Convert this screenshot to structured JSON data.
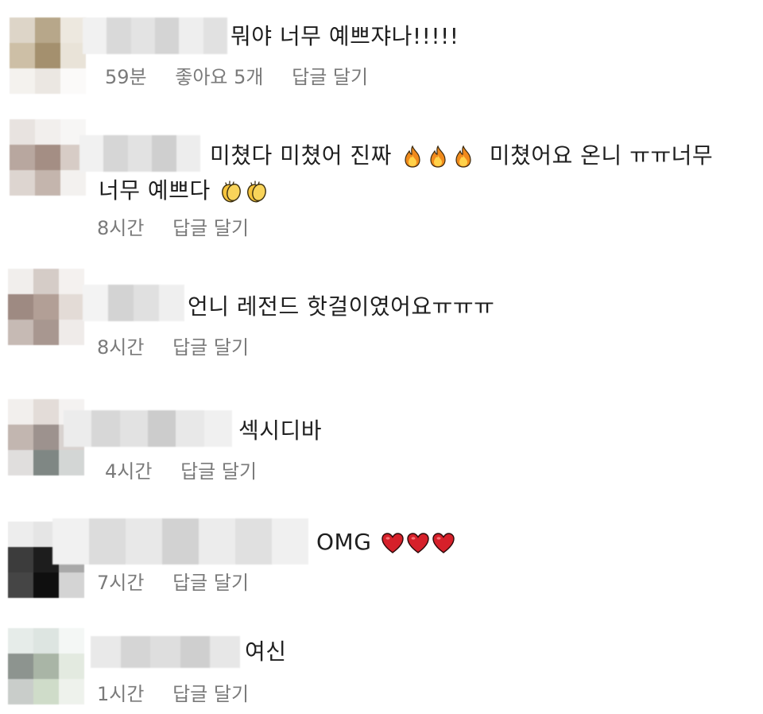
{
  "comments": [
    {
      "text": "뭐야 너무 예쁘쟈나!!!!!",
      "time": "59분",
      "likes": "좋아요 5개",
      "reply": "답글 달기",
      "emoji": [],
      "avatar_colors": [
        "#ddd5c8",
        "#b7a78a",
        "#ede8df",
        "#cdbfa6",
        "#a4906e",
        "#e9e3d8",
        "#f4f2ee",
        "#ebe7e2",
        "#fbfaf9"
      ],
      "name_colors": [
        "#f1f1f1",
        "#d9d9d9",
        "#e3e3e3",
        "#d4d4d4",
        "#eeeeee",
        "#e1e1e1"
      ]
    },
    {
      "text": "미쳤다 미쳤어 진짜",
      "text2": "미쳤어요 온니 ㅠㅠ너무",
      "text3": "너무 예쁘다",
      "time": "8시간",
      "reply": "답글 달기",
      "emoji": [
        "fire",
        "fire",
        "fire"
      ],
      "emoji2": [
        "clap",
        "clap"
      ],
      "avatar_colors": [
        "#e8e3e0",
        "#f2efed",
        "#f7f6f5",
        "#b8a79f",
        "#a48e84",
        "#d7ccc6",
        "#ddd5d0",
        "#c4b5ad",
        "#f3f1ef"
      ],
      "name_colors": [
        "#f1f1f1",
        "#d6d6d6",
        "#e2e2e2",
        "#cfcfcf",
        "#ededed"
      ]
    },
    {
      "text": "언니 레전드 핫걸이였어요ㅠㅠㅠ",
      "time": "8시간",
      "reply": "답글 달기",
      "emoji": [],
      "avatar_colors": [
        "#f1eeec",
        "#d5ccc7",
        "#f4f1ef",
        "#9e8a82",
        "#b29f96",
        "#e3dbd6",
        "#c6bab4",
        "#a89790",
        "#efebe9"
      ],
      "name_colors": [
        "#f3f3f3",
        "#d3d3d3",
        "#e0e0e0",
        "#efefef"
      ]
    },
    {
      "text": "섹시디바",
      "time": "4시간",
      "reply": "답글 달기",
      "emoji": [],
      "avatar_colors": [
        "#f2efed",
        "#e3dcd8",
        "#f4f2f1",
        "#c2b6b0",
        "#9d928e",
        "#d8d2cf",
        "#e0dedd",
        "#7f8784",
        "#d3d6d5"
      ],
      "name_colors": [
        "#ececec",
        "#d7d7d7",
        "#e2e2e2",
        "#cccccc",
        "#e8e8e8",
        "#f0f0f0"
      ]
    },
    {
      "text": "OMG",
      "time": "7시간",
      "reply": "답글 달기",
      "emoji": [
        "heart",
        "heart",
        "heart"
      ],
      "avatar_colors": [
        "#ededed",
        "#e5e5e5",
        "#c7c7c7",
        "#3c3c3c",
        "#1d1d1d",
        "#a9a9a9",
        "#454545",
        "#0f0f0f",
        "#d4d4d4"
      ],
      "name_colors": [
        "#f1f1f1",
        "#dcdcdc",
        "#e8e8e8",
        "#d2d2d2",
        "#ececec",
        "#e0e0e0",
        "#f0f0f0"
      ]
    },
    {
      "text": "여신",
      "time": "1시간",
      "reply": "답글 달기",
      "emoji": [],
      "avatar_colors": [
        "#e6ece9",
        "#dde5e1",
        "#f4f7f5",
        "#8d948f",
        "#a9b5a6",
        "#e3eae0",
        "#c9cdca",
        "#cfdcc9",
        "#eef2ec"
      ],
      "name_colors": [
        "#e9e9e9",
        "#d5d5d5",
        "#dedede",
        "#cfcfcf",
        "#e7e7e7"
      ]
    }
  ]
}
